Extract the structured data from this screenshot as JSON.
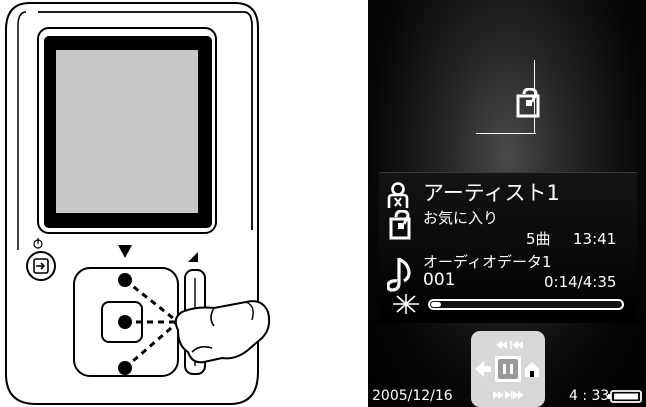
{
  "screen": {
    "artist": "アーティスト1",
    "playlist": "お気に入り",
    "song_count": "5曲",
    "total_time": "13:41",
    "title": "オーディオデータ1",
    "track_number": "001",
    "time_elapsed": "0:14/4:35",
    "progress": 0.05,
    "date": "2005/12/16",
    "clock": "4 : 33",
    "battery_level": "full"
  },
  "icons": {
    "artist": "artist-icon",
    "playlist": "favorite-list-icon",
    "title": "music-note-icon",
    "pause": "pause-icon",
    "back": "back-arrow-icon",
    "home": "home-icon",
    "previous": "previous-skip-icon",
    "next": "next-skip-icon",
    "battery": "battery-icon",
    "hold": "hold-power-icon"
  },
  "colors": {
    "screen_bg": "#000000",
    "screen_text": "#ffffff",
    "control_panel": "#d8d8d8"
  }
}
